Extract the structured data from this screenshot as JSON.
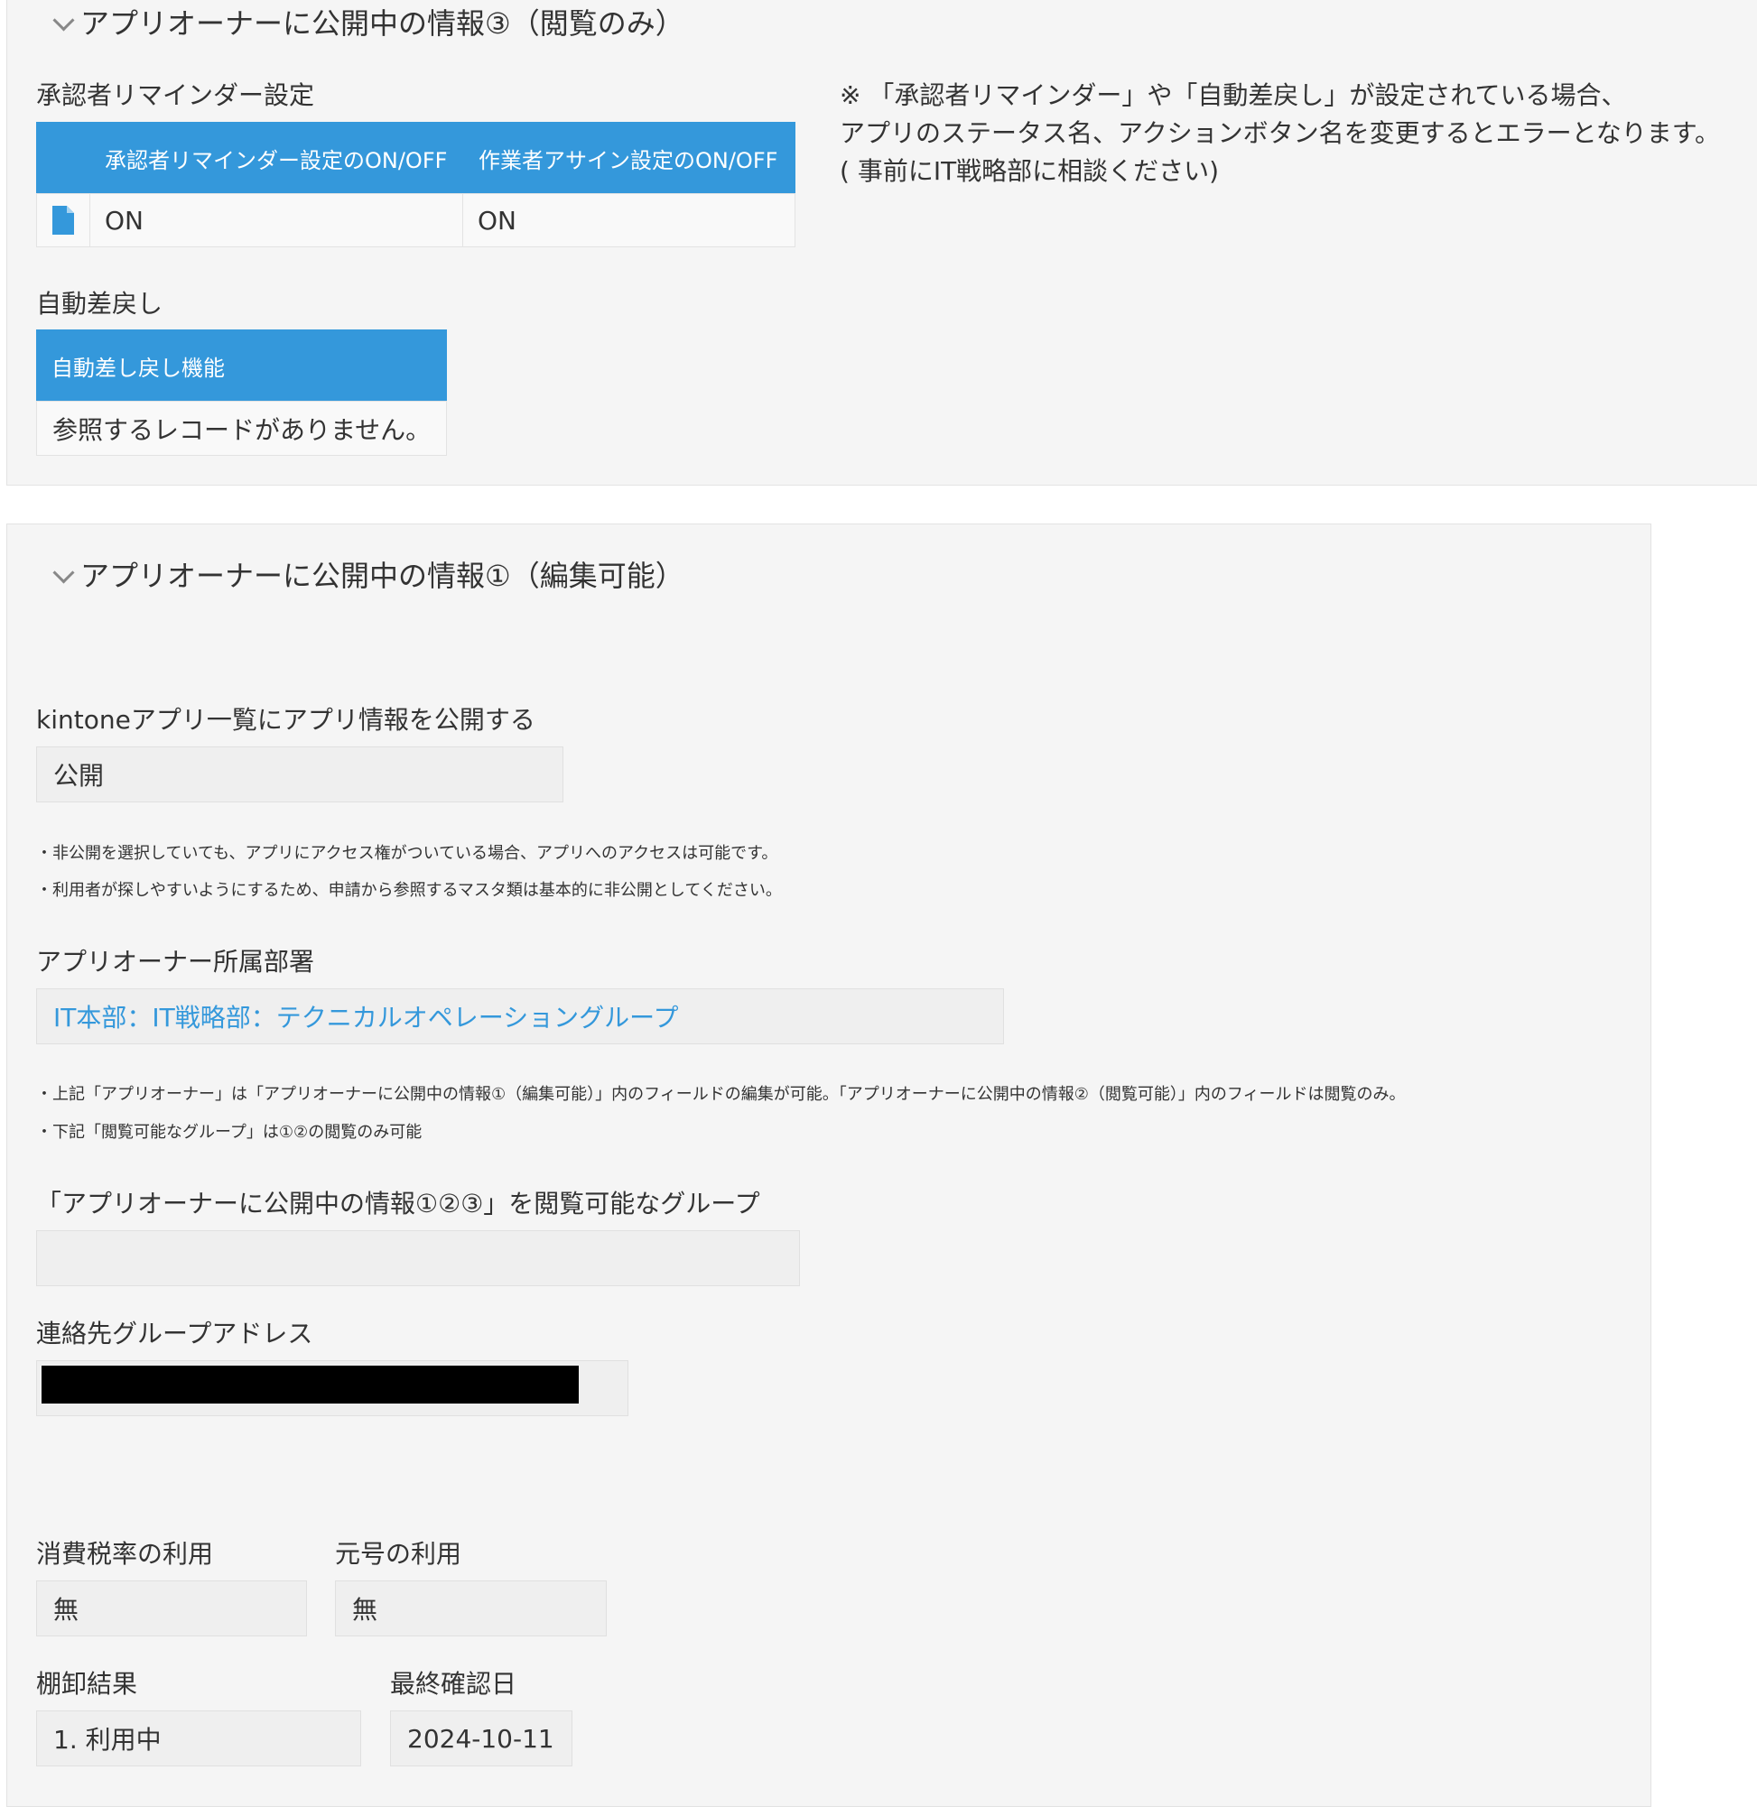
{
  "section3": {
    "title": "アプリオーナーに公開中の情報③（閲覧のみ）",
    "approver_reminder": {
      "label": "承認者リマインダー設定",
      "columns": [
        "承認者リマインダー設定のON/OFF",
        "作業者アサイン設定のON/OFF"
      ],
      "rows": [
        [
          "ON",
          "ON"
        ]
      ]
    },
    "note_lines": [
      "※ 「承認者リマインダー」や「自動差戻し」が設定されている場合、",
      "アプリのステータス名、アクションボタン名を変更するとエラーとなります。",
      "( 事前にIT戦略部に相談ください)"
    ],
    "auto_return": {
      "label": "自動差戻し",
      "column": "自動差し戻し機能",
      "empty_text": "参照するレコードがありません。"
    }
  },
  "section1": {
    "title": "アプリオーナーに公開中の情報①（編集可能）",
    "publish": {
      "label": "kintoneアプリ一覧にアプリ情報を公開する",
      "value": "公開",
      "notes": [
        "・非公開を選択していても、アプリにアクセス権がついている場合、アプリへのアクセスは可能です。",
        "・利用者が探しやすいようにするため、申請から参照するマスタ類は基本的に非公開としてください。"
      ]
    },
    "owner_dept": {
      "label": "アプリオーナー所属部署",
      "value": "IT本部：IT戦略部：テクニカルオペレーショングループ",
      "notes": [
        "・上記「アプリオーナー」は「アプリオーナーに公開中の情報①（編集可能）」内のフィールドの編集が可能。「アプリオーナーに公開中の情報②（閲覧可能）」内のフィールドは閲覧のみ。",
        "・下記「閲覧可能なグループ」は①②の閲覧のみ可能"
      ]
    },
    "viewer_group": {
      "label": "「アプリオーナーに公開中の情報①②③」を閲覧可能なグループ",
      "value": ""
    },
    "contact_address": {
      "label": "連絡先グループアドレス"
    },
    "tax_rate": {
      "label": "消費税率の利用",
      "value": "無"
    },
    "era": {
      "label": "元号の利用",
      "value": "無"
    },
    "inventory": {
      "label": "棚卸結果",
      "value": "1. 利用中"
    },
    "last_checked": {
      "label": "最終確認日",
      "value": "2024-10-11"
    }
  },
  "colors": {
    "accent": "#3498db",
    "panel_bg": "#f5f5f5",
    "field_bg": "#efefef"
  },
  "icons": {
    "record_icon": "document-icon",
    "collapse_icon": "chevron-down-icon"
  }
}
